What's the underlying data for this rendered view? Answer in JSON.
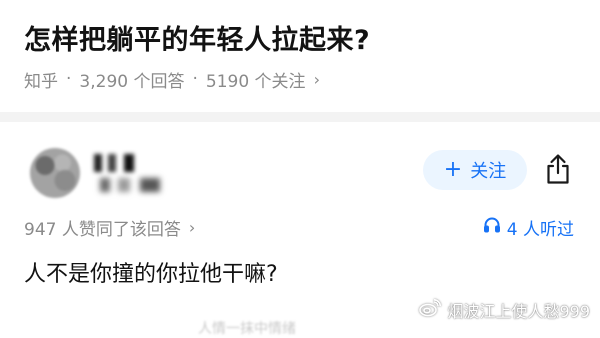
{
  "question": {
    "title": "怎样把躺平的年轻人拉起来?",
    "source": "知乎",
    "answer_count": "3,290 个回答",
    "follower_count": "5190 个关注"
  },
  "answer": {
    "follow_label": "关注",
    "upvote_text": "947 人赞同了该回答",
    "listen_text": "4 人听过",
    "body": "人不是你撞的你拉他干嘛?",
    "faded_next_line": "人情一抹中情绪"
  },
  "watermark": {
    "text": "烟波江上使人愁999"
  },
  "colors": {
    "accent": "#1772f6",
    "follow_bg": "#ebf5ff",
    "muted": "#8a8a8a"
  },
  "icons": [
    "share-icon",
    "headphones-icon",
    "plus-icon",
    "chevron-right-icon",
    "weibo-icon"
  ]
}
